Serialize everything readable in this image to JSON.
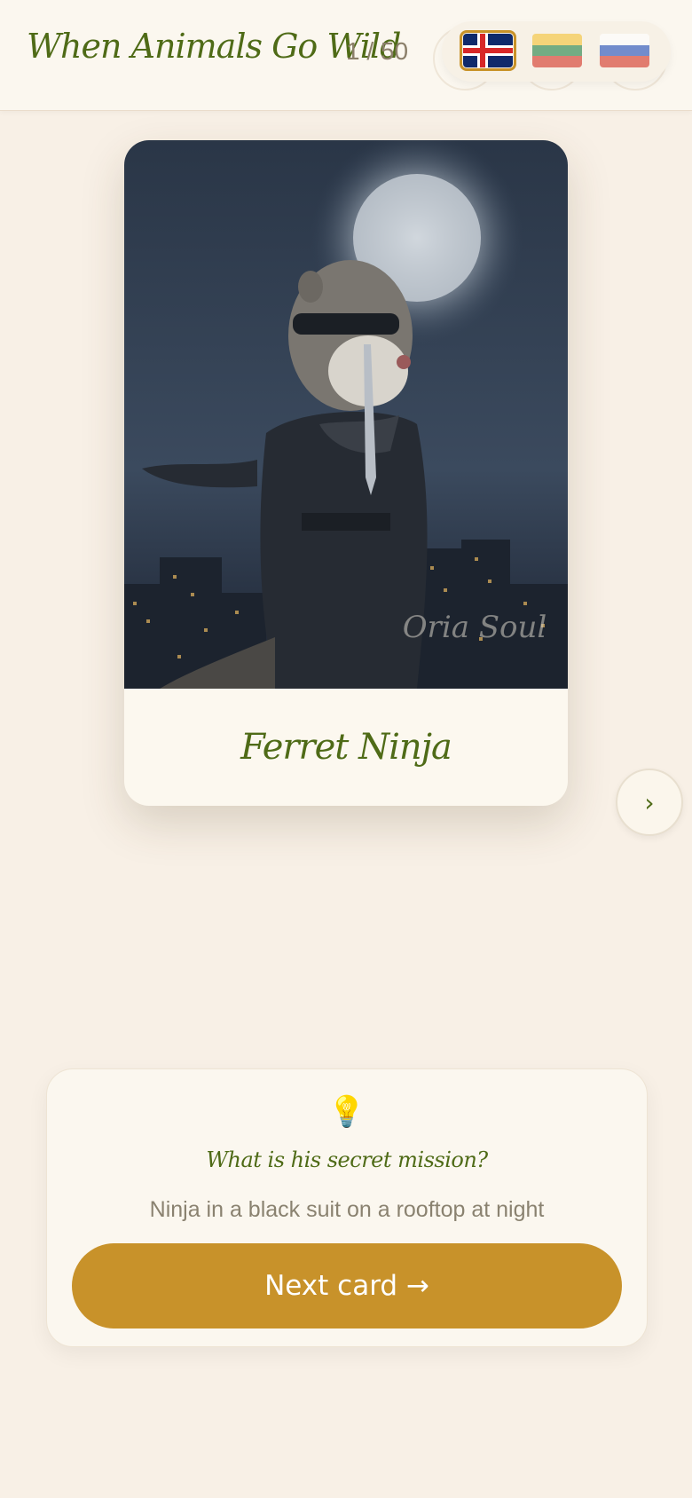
{
  "header": {
    "title": "When Animals Go Wild",
    "counter": "1 / 50",
    "languages": [
      {
        "code": "is",
        "name": "Icelandic",
        "active": true,
        "colors": [
          "#0f2a6b",
          "#ffffff",
          "#d72828"
        ]
      },
      {
        "code": "lt",
        "name": "Lithuanian",
        "active": false,
        "colors": [
          "#f5c84b",
          "#3d8f5a",
          "#d84b3e"
        ]
      },
      {
        "code": "ru",
        "name": "Russian",
        "active": false,
        "colors": [
          "#ffffff",
          "#3a62c2",
          "#d84b3e"
        ]
      }
    ]
  },
  "card": {
    "name": "Ferret Ninja",
    "watermark": "Oria Soul",
    "image_description_icon": "ferret-ninja-image"
  },
  "navigation": {
    "next_icon": "›"
  },
  "hint": {
    "icon": "💡",
    "question": "What is his secret mission?",
    "text": "Ninja in a black suit on a rooftop at night",
    "button_label": "Next card →"
  },
  "colors": {
    "background": "#f8f0e6",
    "accent": "#c8922a",
    "title_green": "#4f6b17"
  }
}
